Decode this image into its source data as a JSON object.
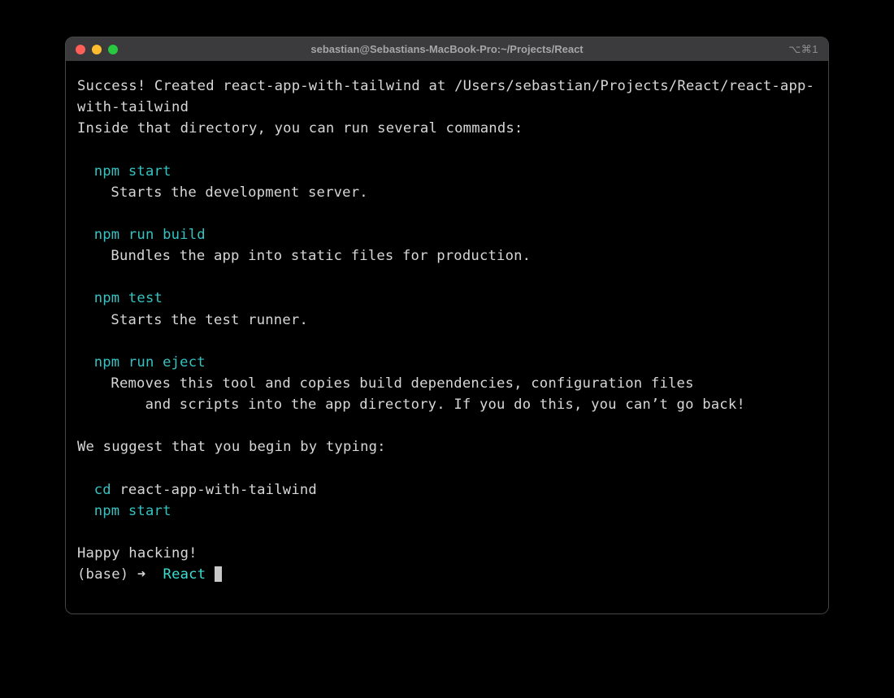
{
  "window": {
    "title": "sebastian@Sebastians-MacBook-Pro:~/Projects/React",
    "shortcut_hint": "⌥⌘1"
  },
  "output": {
    "success_line": "Success! Created react-app-with-tailwind at /Users/sebastian/Projects/React/react-app-with-tailwind",
    "inside_line": "Inside that directory, you can run several commands:",
    "commands": [
      {
        "cmd": "npm start",
        "desc": "Starts the development server."
      },
      {
        "cmd": "npm run build",
        "desc": "Bundles the app into static files for production."
      },
      {
        "cmd": "npm test",
        "desc": "Starts the test runner."
      },
      {
        "cmd": "npm run eject",
        "desc": "Removes this tool and copies build dependencies, configuration files\n    and scripts into the app directory. If you do this, you can’t go back!"
      }
    ],
    "suggest_line": "We suggest that you begin by typing:",
    "suggest_cmds": {
      "cd_cmd": "cd",
      "cd_arg": "react-app-with-tailwind",
      "start_cmd": "npm start"
    },
    "closing": "Happy hacking!"
  },
  "prompt": {
    "env": "(base)",
    "arrow": "➜",
    "dir": "React"
  },
  "colors": {
    "cyan": "#36c2c2",
    "fg": "#d7d7d7",
    "bg": "#000000",
    "titlebar": "#3b3a3c"
  }
}
